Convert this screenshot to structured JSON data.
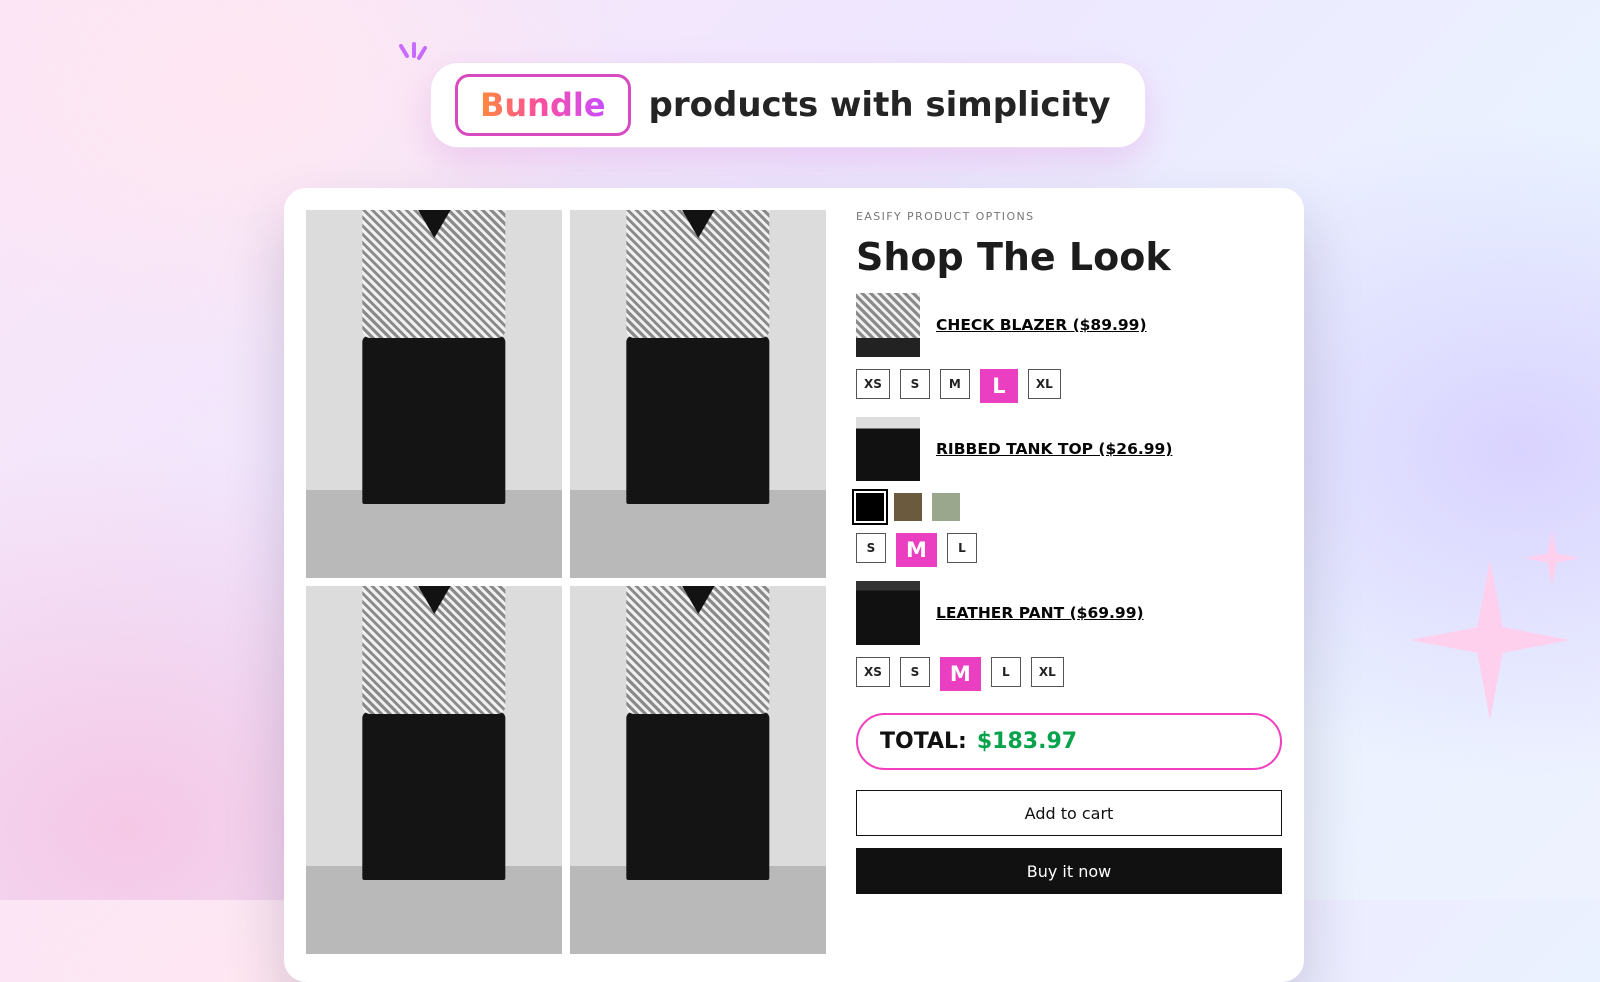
{
  "hero": {
    "chip": "Bundle",
    "rest": "products with simplicity"
  },
  "panel": {
    "eyebrow": "EASIFY PRODUCT OPTIONS",
    "title": "Shop The Look",
    "items": [
      {
        "name": "CHECK BLAZER ($89.99)",
        "price": 89.99,
        "sizes": [
          "XS",
          "S",
          "M",
          "L",
          "XL"
        ],
        "selectedSize": "L"
      },
      {
        "name": "RIBBED TANK TOP ($26.99)",
        "price": 26.99,
        "colors": [
          "#000000",
          "#6b5a3e",
          "#9aa78c"
        ],
        "selectedColorIndex": 0,
        "sizes": [
          "S",
          "M",
          "L"
        ],
        "selectedSize": "M"
      },
      {
        "name": "LEATHER PANT ($69.99)",
        "price": 69.99,
        "sizes": [
          "XS",
          "S",
          "M",
          "L",
          "XL"
        ],
        "selectedSize": "M"
      }
    ],
    "totalLabel": "TOTAL:",
    "totalValue": "$183.97",
    "addToCart": "Add to cart",
    "buyNow": "Buy it now"
  },
  "colors": {
    "accent": "#ea3fc1",
    "total": "#07a34a"
  }
}
